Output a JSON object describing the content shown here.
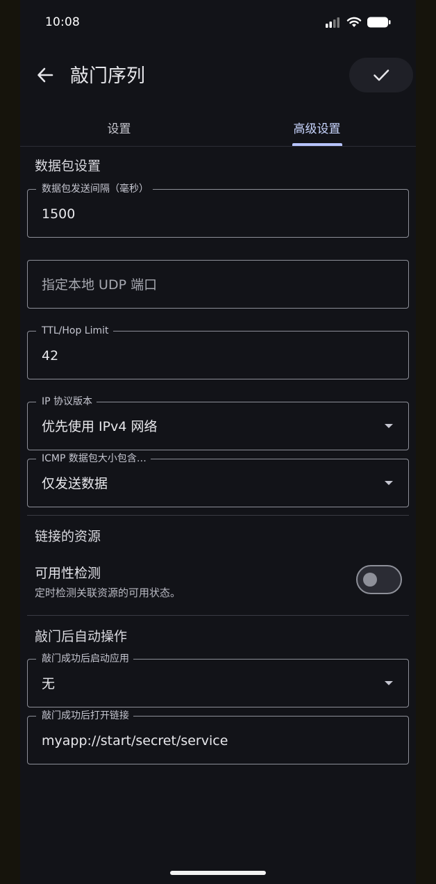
{
  "status_bar": {
    "time": "10:08",
    "icons": [
      "signal-icon",
      "wifi-icon",
      "battery-icon"
    ]
  },
  "app_bar": {
    "title": "敲门序列",
    "back_icon": "arrow-left-icon",
    "confirm_icon": "check-icon"
  },
  "tabs": [
    {
      "label": "设置",
      "selected": false
    },
    {
      "label": "高级设置",
      "selected": true
    }
  ],
  "packet_section": {
    "title": "数据包设置",
    "interval": {
      "label": "数据包发送间隔（毫秒）",
      "value": "1500"
    },
    "udp_port": {
      "placeholder": "指定本地 UDP 端口"
    },
    "ttl": {
      "label": "TTL/Hop Limit",
      "value": "42"
    },
    "ip_version": {
      "label": "IP 协议版本",
      "value": "优先使用 IPv4 网络"
    },
    "icmp_size": {
      "label": "ICMP 数据包大小包含…",
      "value": "仅发送数据"
    }
  },
  "linked_section": {
    "title": "链接的资源",
    "availability": {
      "title": "可用性检测",
      "subtitle": "定时检测关联资源的可用状态。",
      "enabled": false
    }
  },
  "after_section": {
    "title": "敲门后自动操作",
    "launch_app": {
      "label": "敲门成功后启动应用",
      "value": "无"
    },
    "open_link": {
      "label": "敲门成功后打开链接",
      "value": "myapp://start/secret/service"
    }
  },
  "colors": {
    "background": "#121318",
    "accent": "#b7c4ff",
    "outline": "#8e9099"
  }
}
